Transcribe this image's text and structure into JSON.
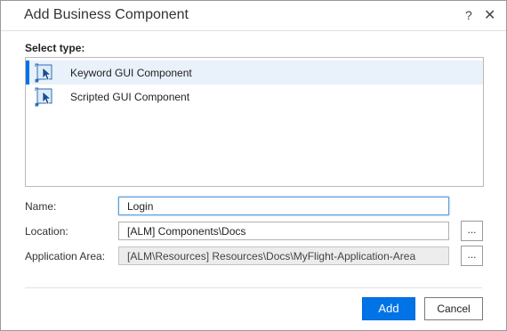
{
  "dialog": {
    "title": "Add Business Component",
    "help_glyph": "?",
    "close_glyph": "✕"
  },
  "select_type": {
    "label": "Select type:",
    "items": [
      {
        "label": "Keyword GUI Component",
        "icon": "keyword-component-icon",
        "selected": true
      },
      {
        "label": "Scripted GUI Component",
        "icon": "scripted-component-icon",
        "selected": false
      }
    ]
  },
  "fields": {
    "name": {
      "label": "Name:",
      "value": "Login"
    },
    "location": {
      "label": "Location:",
      "value": "[ALM] Components\\Docs",
      "browse_label": "..."
    },
    "application_area": {
      "label": "Application Area:",
      "value": "[ALM\\Resources] Resources\\Docs\\MyFlight-Application-Area",
      "browse_label": "..."
    }
  },
  "buttons": {
    "add_label": "Add",
    "cancel_label": "Cancel"
  },
  "colors": {
    "accent": "#0073e7",
    "selected_row": "#e9f1fb",
    "icon_blue": "#2a6db5"
  }
}
